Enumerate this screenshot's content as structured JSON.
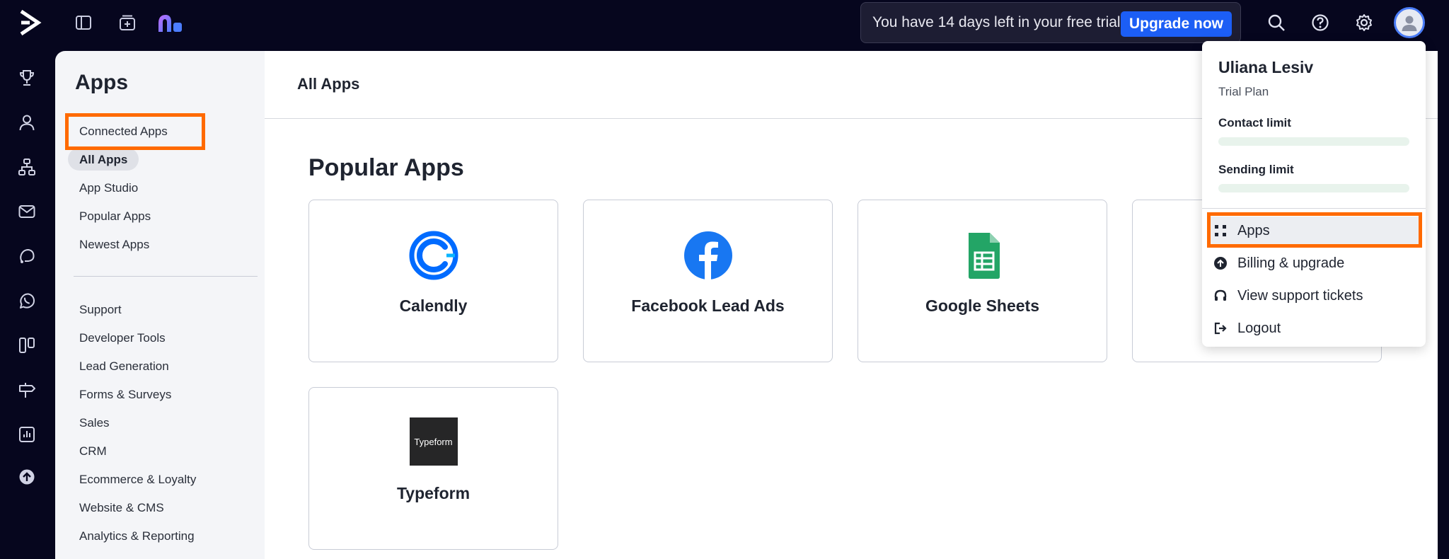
{
  "topbar": {
    "trial_text": "You have 14 days left in your free trial.",
    "upgrade_label": "Upgrade now"
  },
  "sidebar": {
    "title": "Apps",
    "items_top": [
      {
        "label": "Connected Apps"
      },
      {
        "label": "All Apps"
      },
      {
        "label": "App Studio"
      },
      {
        "label": "Popular Apps"
      },
      {
        "label": "Newest Apps"
      }
    ],
    "items_bottom": [
      {
        "label": "Support"
      },
      {
        "label": "Developer Tools"
      },
      {
        "label": "Lead Generation"
      },
      {
        "label": "Forms & Surveys"
      },
      {
        "label": "Sales"
      },
      {
        "label": "CRM"
      },
      {
        "label": "Ecommerce & Loyalty"
      },
      {
        "label": "Website & CMS"
      },
      {
        "label": "Analytics & Reporting"
      }
    ]
  },
  "main": {
    "title": "All Apps",
    "section_title": "Popular Apps",
    "cards": [
      {
        "name": "Calendly"
      },
      {
        "name": "Facebook Lead Ads"
      },
      {
        "name": "Google Sheets"
      },
      {
        "name": ""
      },
      {
        "name": "Typeform",
        "logo_text": "Typeform"
      }
    ]
  },
  "account_menu": {
    "user_name": "Uliana Lesiv",
    "plan": "Trial Plan",
    "contact_limit_label": "Contact limit",
    "contact_limit_fraction": 0.0,
    "sending_limit_label": "Sending limit",
    "sending_limit_fraction": 0.0,
    "items": [
      {
        "label": "Apps",
        "icon": "grid-icon"
      },
      {
        "label": "Billing & upgrade",
        "icon": "upgrade-circle-icon"
      },
      {
        "label": "View support tickets",
        "icon": "headset-icon"
      },
      {
        "label": "Logout",
        "icon": "logout-icon"
      }
    ]
  },
  "colors": {
    "topbar_bg": "#06061e",
    "accent_blue": "#1c5ef5",
    "highlight_orange": "#ff6a00",
    "calendly_blue": "#006bff",
    "facebook_blue": "#1877f2",
    "sheets_green": "#23a566"
  }
}
